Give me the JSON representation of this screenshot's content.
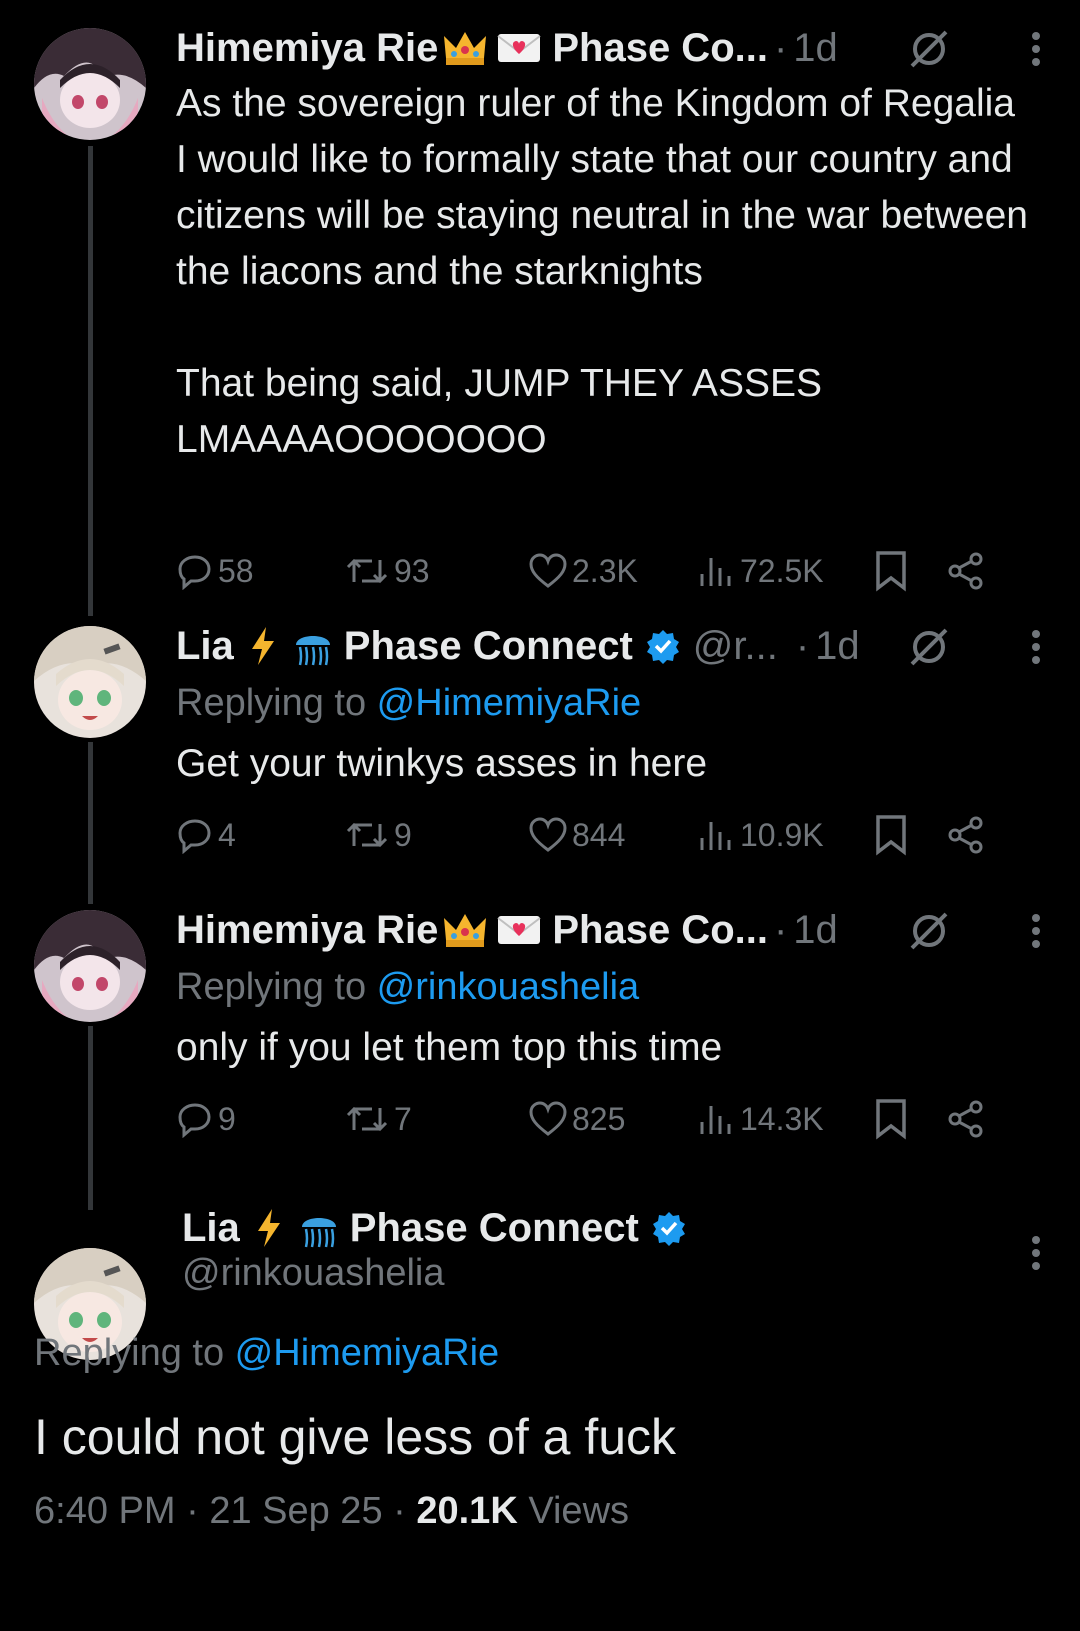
{
  "tweets": [
    {
      "name": "Himemiya Rie",
      "affiliation": "Phase Co...",
      "time": "1d",
      "text": "As the sovereign ruler of the Kingdom of Regalia I would like to formally state that our country and citizens will be staying neutral in the war between the liacons and the starknights\n\nThat being said, JUMP THEY ASSES LMAAAAOOOOOOO",
      "replies": "58",
      "reposts": "93",
      "likes": "2.3K",
      "views": "72.5K"
    },
    {
      "name": "Lia",
      "affiliation": "Phase Connect",
      "handle_short": "@r...",
      "time": "1d",
      "reply_label": "Replying to ",
      "reply_handle": "@HimemiyaRie",
      "text": "Get your twinkys asses in here",
      "replies": "4",
      "reposts": "9",
      "likes": "844",
      "views": "10.9K"
    },
    {
      "name": "Himemiya Rie",
      "affiliation": "Phase Co...",
      "time": "1d",
      "reply_label": "Replying to ",
      "reply_handle": "@rinkouashelia",
      "text": "only if you let them top this time",
      "replies": "9",
      "reposts": "7",
      "likes": "825",
      "views": "14.3K"
    }
  ],
  "main": {
    "name": "Lia",
    "affiliation": "Phase Connect",
    "handle": "@rinkouashelia",
    "reply_label": "Replying to ",
    "reply_handle": "@HimemiyaRie",
    "text": "I could not give less of a fuck",
    "time": "6:40 PM",
    "date": "21 Sep 25",
    "views_count": "20.1K",
    "views_label": "Views"
  },
  "colors": {
    "background": "#000000",
    "text": "#e7e9ea",
    "muted": "#71767b",
    "link": "#1d9bf0",
    "verified": "#1d9bf0"
  }
}
